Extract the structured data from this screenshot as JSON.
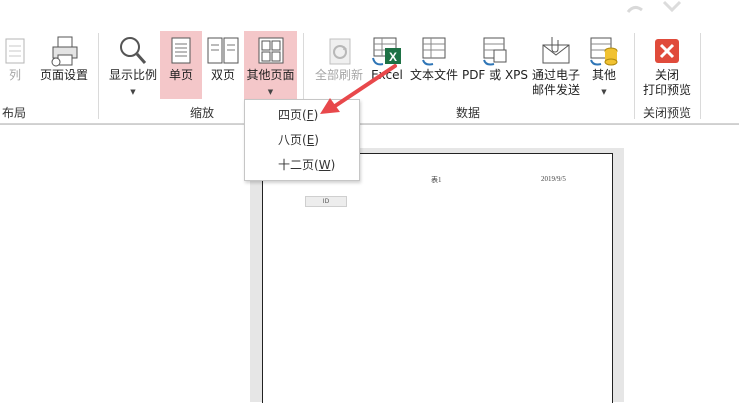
{
  "ribbon": {
    "left_partial": {
      "col_label": "列",
      "group": "布局"
    },
    "page_setup": "页面设置",
    "zoom_group": {
      "label": "缩放",
      "show_ratio": "显示比例",
      "single_page": "单页",
      "two_pages": "双页",
      "more_pages": "其他页面"
    },
    "data_group": {
      "label": "数据",
      "refresh_all": "全部刷新",
      "excel": "Excel",
      "text_file": "文本文件",
      "pdf_xps": "PDF 或 XPS",
      "email_line1": "通过电子",
      "email_line2": "邮件发送",
      "other": "其他"
    },
    "close_group": {
      "label": "关闭预览",
      "close_line1": "关闭",
      "close_line2": "打印预览"
    }
  },
  "dropdown": {
    "items": [
      {
        "label": "四页(",
        "key": "F",
        "end": ")"
      },
      {
        "label": "八页(",
        "key": "E",
        "end": ")"
      },
      {
        "label": "十二页(",
        "key": "W",
        "end": ")"
      }
    ]
  },
  "preview": {
    "header_center": "表1",
    "header_right": "2019/9/5",
    "cell_text": "ID"
  },
  "colors": {
    "selected_bg": "#f4c7c9",
    "arrow": "#e8484b",
    "close_icon": "#e04b3b",
    "excel_green": "#1e7145"
  }
}
